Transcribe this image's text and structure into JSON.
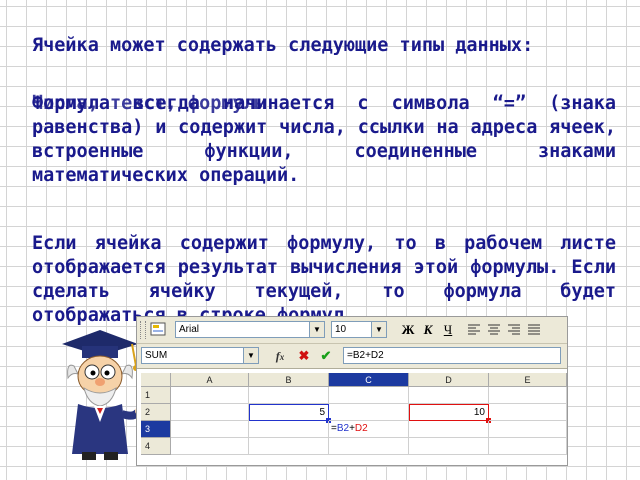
{
  "slide": {
    "paragraph1": "Ячейка может содержать следующие типы данных:",
    "overlay_text": "Числа, текст, формулы",
    "paragraph2": "Формула всегда начинается с символа “=” (знака равенства) и содержит числа, ссылки на адреса ячеек, встроенные функции, соединенные знаками математических операций.",
    "paragraph3": "Если ячейка содержит формулу, то в рабочем листе отображается результат вычисления этой формулы. Если сделать ячейку текущей, то формула будет отображаться в строке формул."
  },
  "toolbar": {
    "font_name": "Arial",
    "font_size": "10",
    "bold_label": "Ж",
    "italic_label": "К",
    "underline_label": "Ч"
  },
  "formula_bar": {
    "name_box": "SUM",
    "formula": "=B2+D2"
  },
  "grid": {
    "columns": [
      "A",
      "B",
      "C",
      "D",
      "E"
    ],
    "rows": [
      "1",
      "2",
      "3",
      "4"
    ],
    "b2_value": "5",
    "d2_value": "10",
    "c3_formula": {
      "eq": "=",
      "ref1": "B2",
      "plus": "+",
      "ref2": "D2"
    }
  },
  "colors": {
    "slide_text": "#1a1a8c",
    "selected_header": "#1c3aa0",
    "ref_b2": "#2233cc",
    "ref_d2": "#e01010"
  }
}
